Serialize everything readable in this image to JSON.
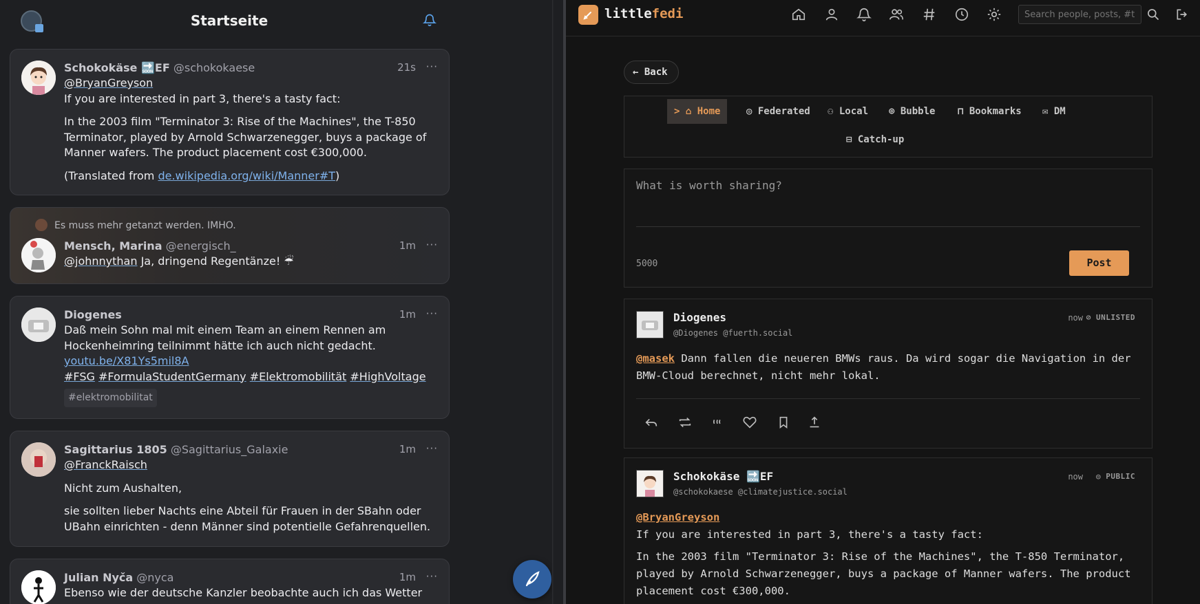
{
  "left": {
    "title": "Startseite",
    "posts": [
      {
        "display_name": "Schokokäse 🔜EF",
        "handle": "@schokokaese",
        "time": "21s",
        "more": "···",
        "mention": "@BryanGreyson",
        "lines": [
          "If you are interested in part 3, there's a tasty fact:",
          "In the 2003 film \"Terminator 3: Rise of the Machines\", the T-850 Terminator, played by Arnold Schwarzenegger, buys a package of Manner wafers. The product placement cost €300,000."
        ],
        "translated_prefix": "(Translated from ",
        "translated_link": "de.wikipedia.org/wiki/Manner#T",
        "translated_suffix": ")"
      },
      {
        "boost_text": "Es muss mehr getanzt werden. IMHO.",
        "display_name": "Mensch, Marina",
        "handle": "@energisch_",
        "time": "1m",
        "more": "···",
        "mention": "@johnnythan",
        "text": " Ja, dringend Regentänze! ☔"
      },
      {
        "display_name": "Diogenes",
        "handle": "",
        "time": "1m",
        "more": "···",
        "text": "Daß mein Sohn mal mit einem Team an einem Rennen am Hockenheimring teilnimmt hätte ich auch nicht gedacht.",
        "link": "youtu.be/X81Ys5mil8A",
        "hashtags": [
          "#FSG",
          "#FormulaStudentGermany",
          "#Elektromobilität",
          "#HighVoltage"
        ],
        "chip": "#elektromobilitat"
      },
      {
        "display_name": "Sagittarius 1805",
        "handle": "@Sagittarius_Galaxie",
        "time": "1m",
        "more": "···",
        "mention": "@FranckRaisch",
        "lines": [
          "Nicht zum Aushalten,",
          "sie sollten lieber Nachts eine Abteil für Frauen in der SBahn oder UBahn einrichten -  denn Männer sind potentielle Gefahrenquellen."
        ]
      },
      {
        "display_name": "Julian Nyča",
        "handle": "@nyca",
        "time": "1m",
        "more": "···",
        "text": "Ebenso wie der deutsche Kanzler beobachte auch ich das Wetter genau."
      }
    ]
  },
  "right": {
    "logo_a": "little",
    "logo_b": "fedi",
    "search_placeholder": "Search people, posts, #tags",
    "back_label": "Back",
    "tabs": [
      {
        "label": "> ⌂ Home"
      },
      {
        "label": "Federated"
      },
      {
        "label": "Local"
      },
      {
        "label": "Bubble"
      },
      {
        "label": "Bookmarks"
      },
      {
        "label": "DM"
      },
      {
        "label": "Catch-up"
      }
    ],
    "composer_placeholder": "What is worth sharing?",
    "char_count": "5000",
    "post_label": "Post",
    "posts": [
      {
        "name": "Diogenes",
        "handle": "@Diogenes @fuerth.social",
        "time": "now",
        "visibility": "UNLISTED",
        "mention": "@masek",
        "text": " Dann fallen die neueren BMWs raus. Da wird sogar die Navigation in der BMW-Cloud berechnet, nicht mehr lokal."
      },
      {
        "name": "Schokokäse 🔜EF",
        "handle": "@schokokaese @climatejustice.social",
        "time": "now",
        "visibility": "PUBLIC",
        "mention": "@BryanGreyson",
        "lines": [
          "If you are interested in part 3, there's a tasty fact:",
          "In the 2003 film \"Terminator 3: Rise of the Machines\", the T-850 Terminator, played by Arnold Schwarzenegger, buys a package of Manner wafers. The product placement cost €300,000."
        ]
      }
    ]
  },
  "colors": {
    "accent": "#e59a57",
    "left_bg": "#1e1f22",
    "right_bg": "#141414",
    "link": "#7fb2ec"
  }
}
